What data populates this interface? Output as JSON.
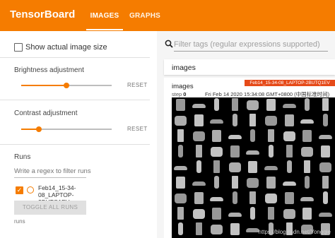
{
  "topbar": {
    "brand": "TensorBoard",
    "tabs": [
      {
        "label": "IMAGES",
        "active": true
      },
      {
        "label": "GRAPHS",
        "active": false
      }
    ],
    "color": "#f57c00"
  },
  "sidebar": {
    "show_actual_size": {
      "label": "Show actual image size",
      "checked": false
    },
    "brightness": {
      "label": "Brightness adjustment",
      "value": 0.5,
      "reset_label": "RESET"
    },
    "contrast": {
      "label": "Contrast adjustment",
      "value": 0.2,
      "reset_label": "RESET"
    },
    "runs": {
      "heading": "Runs",
      "filter_placeholder": "Write a regex to filter runs",
      "items": [
        {
          "name": "Feb14_15-34-08_LAPTOP-2BUTQ1EV",
          "checked": true
        }
      ],
      "toggle_label": "TOGGLE ALL RUNS",
      "footer": "runs"
    }
  },
  "main": {
    "search": {
      "placeholder": "Filter tags (regular expressions supported)",
      "icon": "search-icon"
    },
    "pane_title": "images",
    "card": {
      "title": "images",
      "run_badge": "Feb14_15-34-08_LAPTOP-2BUTQ1EV",
      "step_label": "step",
      "step_value": "0",
      "timestamp": "Fri Feb 14 2020 15:34:08 GMT+0800 (中国标准时间)",
      "badge_color": "#e64a19"
    },
    "watermark": "https://blog.csdn.net/Yongqie"
  }
}
